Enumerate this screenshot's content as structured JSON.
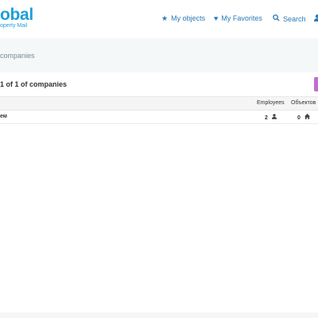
{
  "logo": {
    "main": "obal",
    "sub": "operty Mail"
  },
  "nav": {
    "objects": {
      "label": "My objects",
      "icon": "star-icon"
    },
    "favorites": {
      "label": "My Favorites",
      "icon": "heart-icon"
    },
    "search": {
      "label": "Search",
      "icon": "search-icon"
    },
    "user": {
      "icon": "user-icon"
    }
  },
  "banner": {
    "title": "companies"
  },
  "list": {
    "count_text": "1 of 1 of companies"
  },
  "table": {
    "headers": {
      "employees": "Employees",
      "objects": "Объектов"
    },
    "rows": [
      {
        "name": "ем",
        "employees": "2",
        "objects": "0"
      }
    ]
  },
  "colors": {
    "accent": "#1e9fd8",
    "nav": "#2b7ab8",
    "add_button": "#c06fd0"
  }
}
